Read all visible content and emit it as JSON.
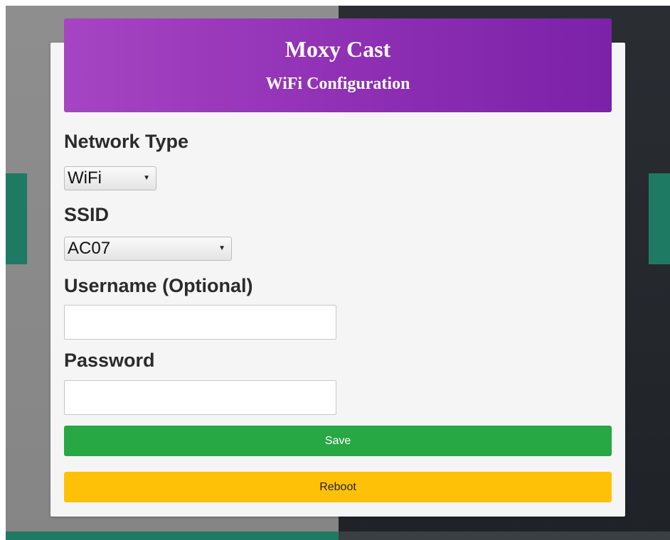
{
  "header": {
    "title": "Moxy Cast",
    "subtitle": "WiFi Configuration"
  },
  "form": {
    "network_type": {
      "label": "Network Type",
      "selected": "WiFi"
    },
    "ssid": {
      "label": "SSID",
      "selected": "AC07"
    },
    "username": {
      "label": "Username (Optional)",
      "value": "",
      "placeholder": ""
    },
    "password": {
      "label": "Password",
      "value": "",
      "placeholder": ""
    }
  },
  "buttons": {
    "save_label": "Save",
    "reboot_label": "Reboot"
  },
  "colors": {
    "header_start": "#a645c2",
    "header_end": "#7b22a8",
    "save": "#28a745",
    "reboot": "#ffc107"
  },
  "icons": {
    "select_arrow": "chevron-down-icon"
  }
}
